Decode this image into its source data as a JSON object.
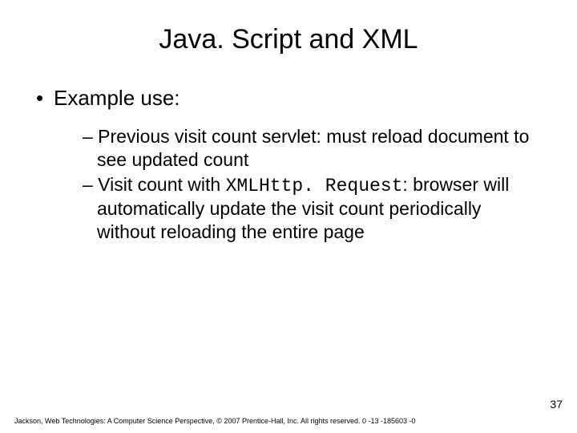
{
  "title": "Java. Script and XML",
  "bullet1": "Example use:",
  "sub1_pre": "– Previous visit count servlet: must reload document to see updated count",
  "sub2_pre": "– Visit count with ",
  "sub2_code": "XMLHttp. Request",
  "sub2_post": ": browser will automatically update the visit count periodically without reloading the entire page",
  "page_number": "37",
  "footer": "Jackson, Web Technologies: A Computer Science Perspective, © 2007 Prentice-Hall, Inc. All rights reserved. 0 -13 -185603 -0"
}
